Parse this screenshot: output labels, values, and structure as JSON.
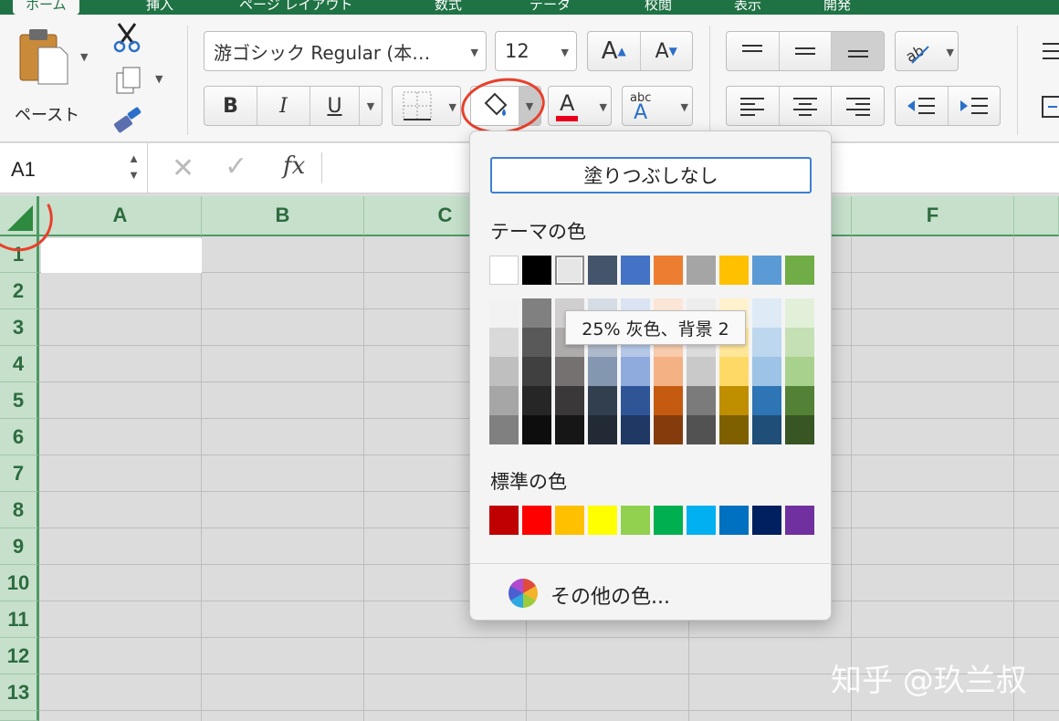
{
  "tabs": [
    {
      "label": "ホーム",
      "active": true
    },
    {
      "label": "挿入",
      "active": false
    },
    {
      "label": "ページ レイアウト",
      "active": false
    },
    {
      "label": "数式",
      "active": false
    },
    {
      "label": "データ",
      "active": false
    },
    {
      "label": "校閲",
      "active": false
    },
    {
      "label": "表示",
      "active": false
    },
    {
      "label": "開発",
      "active": false
    }
  ],
  "ribbon": {
    "paste_label": "ペースト",
    "font_name": "游ゴシック Regular (本…",
    "font_size": "12",
    "bold": "B",
    "italic": "I",
    "underline": "U",
    "font_color_letter": "A",
    "abc_label": "abc"
  },
  "formula_bar": {
    "cell_ref": "A1",
    "fx": "fx"
  },
  "grid": {
    "columns": [
      "A",
      "B",
      "C",
      "",
      "",
      "F"
    ],
    "rows": [
      "1",
      "2",
      "3",
      "4",
      "5",
      "6",
      "7",
      "8",
      "9",
      "10",
      "11",
      "12",
      "13"
    ]
  },
  "fill_popup": {
    "no_fill": "塗りつぶしなし",
    "theme_title": "テーマの色",
    "theme_colors": [
      "#ffffff",
      "#000000",
      "#e7e6e6",
      "#44546a",
      "#4472c4",
      "#ed7d31",
      "#a5a5a5",
      "#ffc000",
      "#5b9bd5",
      "#70ad47"
    ],
    "theme_shades": [
      [
        "#f2f2f2",
        "#d9d9d9",
        "#bfbfbf",
        "#a6a6a6",
        "#808080"
      ],
      [
        "#808080",
        "#595959",
        "#404040",
        "#262626",
        "#0d0d0d"
      ],
      [
        "#d0cece",
        "#aeabab",
        "#757171",
        "#3a3838",
        "#171616"
      ],
      [
        "#d6dce4",
        "#adb9ca",
        "#8497b0",
        "#323f4f",
        "#222b35"
      ],
      [
        "#dae3f3",
        "#b4c7e7",
        "#8faadc",
        "#2f5597",
        "#1f3864"
      ],
      [
        "#fbe5d6",
        "#f8cbad",
        "#f4b183",
        "#c55a11",
        "#843c0c"
      ],
      [
        "#ededed",
        "#dbdbdb",
        "#c9c9c9",
        "#7b7b7b",
        "#525252"
      ],
      [
        "#fff2cc",
        "#ffe699",
        "#ffd966",
        "#bf8f00",
        "#7f6000"
      ],
      [
        "#deebf7",
        "#bdd7ee",
        "#9dc3e6",
        "#2e75b6",
        "#1f4e79"
      ],
      [
        "#e2f0d9",
        "#c5e0b4",
        "#a9d18e",
        "#538135",
        "#375623"
      ]
    ],
    "tooltip": "25% 灰色、背景 2",
    "standard_title": "標準の色",
    "standard_colors": [
      "#c00000",
      "#ff0000",
      "#ffc000",
      "#ffff00",
      "#92d050",
      "#00b050",
      "#00b0f0",
      "#0070c0",
      "#002060",
      "#7030a0"
    ],
    "more_colors": "その他の色..."
  },
  "watermark": "知乎 @玖兰叔"
}
